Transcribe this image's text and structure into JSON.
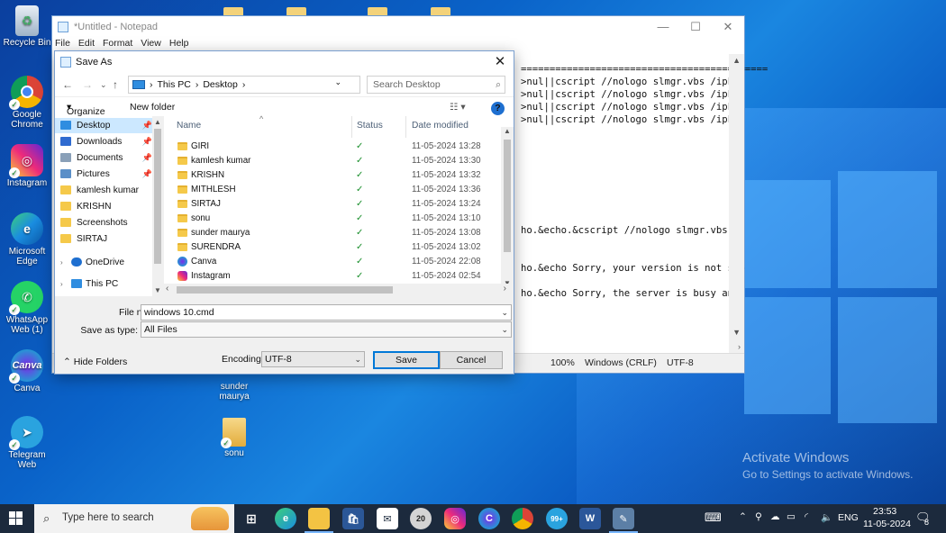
{
  "desktop": {
    "icons": [
      {
        "name": "recycle-bin",
        "label": "Recycle Bin"
      },
      {
        "name": "google-chrome",
        "label": "Google Chrome"
      },
      {
        "name": "instagram",
        "label": "Instagram"
      },
      {
        "name": "microsoft-edge",
        "label": "Microsoft Edge"
      },
      {
        "name": "whatsapp",
        "label": "WhatsApp Web (1)"
      },
      {
        "name": "canva",
        "label": "Canva"
      },
      {
        "name": "telegram",
        "label": "Telegram Web"
      },
      {
        "name": "sunder-maurya",
        "label": "sunder maurya"
      },
      {
        "name": "sonu",
        "label": "sonu"
      }
    ],
    "watermark": {
      "title": "Activate Windows",
      "subtitle": "Go to Settings to activate Windows."
    }
  },
  "notepad": {
    "title": "*Untitled - Notepad",
    "menu": [
      "File",
      "Edit",
      "Format",
      "View",
      "Help"
    ],
    "lines": [
      "===========================================",
      ">nul||cscript //nologo slmgr.vbs /ipk",
      ">nul||cscript //nologo slmgr.vbs /ipk",
      ">nul||cscript //nologo slmgr.vbs /ipk",
      ">nul||cscript //nologo slmgr.vbs /ipk",
      "ho.&echo.&cscript //nologo slmgr.vbs /a",
      "ho.&echo Sorry, your version is not sup",
      "ho.&echo Sorry, the server is busy and"
    ],
    "status": {
      "zoom": "100%",
      "line_ending": "Windows (CRLF)",
      "encoding": "UTF-8"
    }
  },
  "saveas": {
    "title": "Save As",
    "breadcrumb": [
      "This PC",
      "Desktop"
    ],
    "search_placeholder": "Search Desktop",
    "organize": "Organize",
    "new_folder": "New folder",
    "nav": [
      {
        "label": "Desktop",
        "pinned": true,
        "selected": true,
        "icon": "desktop-icon",
        "color": "#2f8de0"
      },
      {
        "label": "Downloads",
        "pinned": true,
        "icon": "download-icon",
        "color": "#2f6bd0"
      },
      {
        "label": "Documents",
        "pinned": true,
        "icon": "document-icon",
        "color": "#8aa0b8"
      },
      {
        "label": "Pictures",
        "pinned": true,
        "icon": "picture-icon",
        "color": "#5a8fc8"
      },
      {
        "label": "kamlesh kumar",
        "icon": "folder-icon",
        "color": "#f5c94a"
      },
      {
        "label": "KRISHN",
        "icon": "folder-icon",
        "color": "#f5c94a"
      },
      {
        "label": "Screenshots",
        "icon": "folder-icon",
        "color": "#f5c94a"
      },
      {
        "label": "SIRTAJ",
        "icon": "folder-icon",
        "color": "#f5c94a"
      },
      {
        "label": "OneDrive",
        "icon": "onedrive-icon",
        "color": "#1e6fd0"
      },
      {
        "label": "This PC",
        "icon": "pc-icon",
        "color": "#2f8de0"
      }
    ],
    "columns": {
      "name": "Name",
      "status": "Status",
      "date": "Date modified"
    },
    "files": [
      {
        "name": "GIRI",
        "status": "✓",
        "date": "11-05-2024 13:28",
        "kind": "folder"
      },
      {
        "name": "kamlesh kumar",
        "status": "✓",
        "date": "11-05-2024 13:30",
        "kind": "folder"
      },
      {
        "name": "KRISHN",
        "status": "✓",
        "date": "11-05-2024 13:32",
        "kind": "folder"
      },
      {
        "name": "MITHLESH",
        "status": "✓",
        "date": "11-05-2024 13:36",
        "kind": "folder"
      },
      {
        "name": "SIRTAJ",
        "status": "✓",
        "date": "11-05-2024 13:24",
        "kind": "folder"
      },
      {
        "name": "sonu",
        "status": "✓",
        "date": "11-05-2024 13:10",
        "kind": "folder"
      },
      {
        "name": "sunder maurya",
        "status": "✓",
        "date": "11-05-2024 13:08",
        "kind": "folder"
      },
      {
        "name": "SURENDRA",
        "status": "✓",
        "date": "11-05-2024 13:02",
        "kind": "folder"
      },
      {
        "name": "Canva",
        "status": "✓",
        "date": "11-05-2024 22:08",
        "kind": "canva"
      },
      {
        "name": "Instagram",
        "status": "✓",
        "date": "11-05-2024 02:54",
        "kind": "insta"
      }
    ],
    "file_name_label": "File name:",
    "file_name_value": "windows 10.cmd",
    "save_type_label": "Save as type:",
    "save_type_value": "All Files",
    "hide_folders": "Hide Folders",
    "encoding_label": "Encoding:",
    "encoding_value": "UTF-8",
    "save": "Save",
    "cancel": "Cancel"
  },
  "taskbar": {
    "search_placeholder": "Type here to search",
    "apps": [
      "task-view",
      "edge",
      "file-explorer",
      "store",
      "mail",
      "chrome-20",
      "instagram",
      "canva",
      "chrome",
      "telegram-99",
      "word",
      "notepad"
    ],
    "lang": "ENG",
    "time": "23:53",
    "date": "11-05-2024",
    "notif_count": "8"
  }
}
